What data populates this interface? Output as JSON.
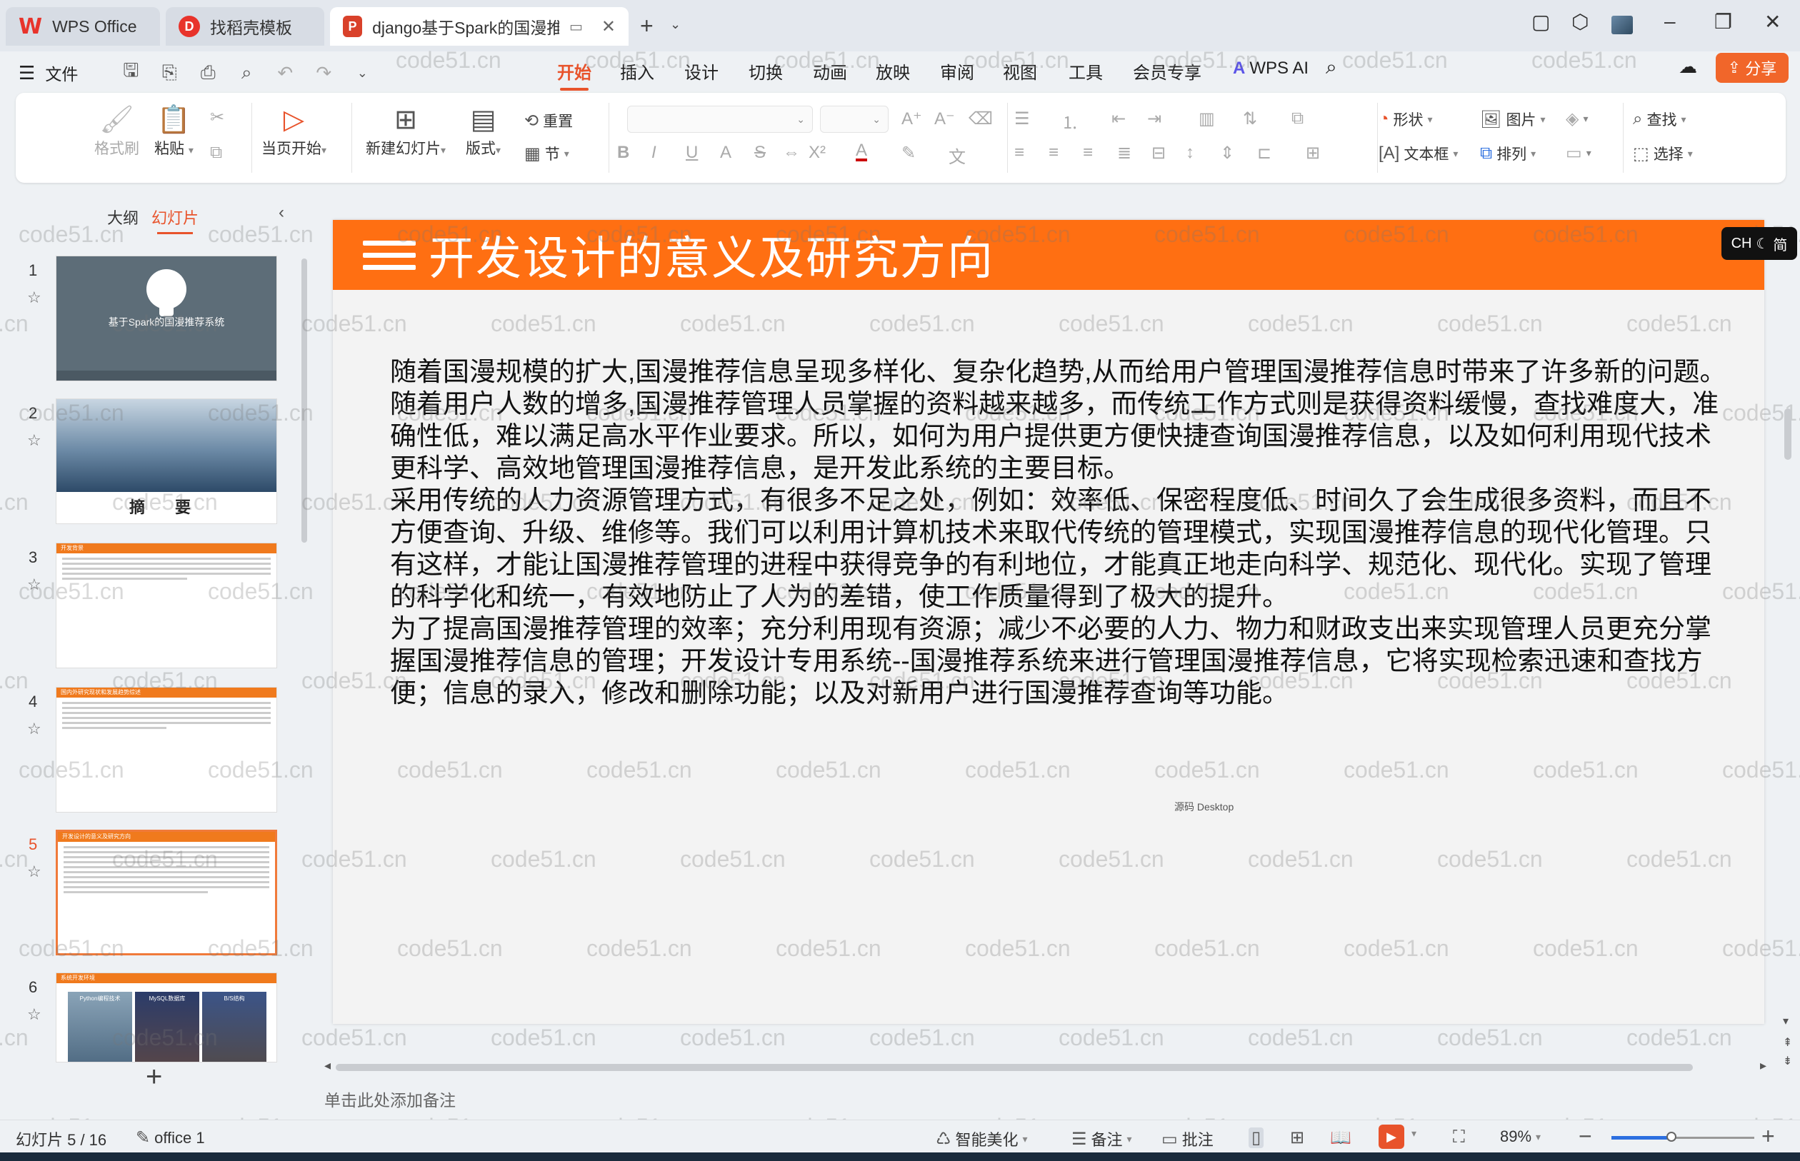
{
  "tabs": [
    {
      "label": "WPS Office",
      "icon": "wps-logo-icon"
    },
    {
      "label": "找稻壳模板",
      "icon": "docer-logo-icon"
    },
    {
      "label": "django基于Spark的国漫推荐",
      "icon": "presentation-logo-icon"
    }
  ],
  "menu": {
    "file": "文件",
    "tabs": [
      "开始",
      "插入",
      "设计",
      "切换",
      "动画",
      "放映",
      "审阅",
      "视图",
      "工具",
      "会员专享"
    ],
    "active_tab": "开始",
    "wps_ai": "WPS AI",
    "share": "分享"
  },
  "ribbon": {
    "format_painter": "格式刷",
    "paste": "粘贴",
    "play_from_current": "当页开始",
    "new_slide": "新建幻灯片",
    "layout": "版式",
    "reset": "重置",
    "section": "节",
    "shape": "形状",
    "picture": "图片",
    "textbox": "文本框",
    "arrange": "排列",
    "find": "查找",
    "select": "选择"
  },
  "panel": {
    "outline_tab": "大纲",
    "slides_tab": "幻灯片",
    "slides": [
      {
        "num": "1",
        "title": "基于Spark的国漫推荐系统"
      },
      {
        "num": "2",
        "title": "摘 要"
      },
      {
        "num": "3",
        "title": "开发背景"
      },
      {
        "num": "4",
        "title": "国内外研究现状和发展趋势综述"
      },
      {
        "num": "5",
        "title": "开发设计的意义及研究方向"
      },
      {
        "num": "6",
        "title": "系统开发环境",
        "pics": [
          "Python编程技术",
          "MySQL数据库",
          "B/S结构"
        ]
      }
    ],
    "active_slide": "5"
  },
  "slide": {
    "title": "开发设计的意义及研究方向",
    "paragraphs": [
      "随着国漫规模的扩大,国漫推荐信息呈现多样化、复杂化趋势,从而给用户管理国漫推荐信息时带来了许多新的问题。随着用户人数的增多,国漫推荐管理人员掌握的资料越来越多，而传统工作方式则是获得资料缓慢，查找难度大，准确性低，难以满足高水平作业要求。所以，如何为用户提供更方便快捷查询国漫推荐信息，以及如何利用现代技术更科学、高效地管理国漫推荐信息，是开发此系统的主要目标。",
      "采用传统的人力资源管理方式，有很多不足之处，例如：效率低、保密程度低、时间久了会生成很多资料，而且不方便查询、升级、维修等。我们可以利用计算机技术来取代传统的管理模式，实现国漫推荐信息的现代化管理。只有这样，才能让国漫推荐管理的进程中获得竞争的有利地位，才能真正地走向科学、规范化、现代化。实现了管理的科学化和统一，有效地防止了人为的差错，使工作质量得到了极大的提升。",
      "为了提高国漫推荐管理的效率；充分利用现有资源；减少不必要的人力、物力和财政支出来实现管理人员更充分掌握国漫推荐信息的管理；开发设计专用系统--国漫推荐系统来进行管理国漫推荐信息，它将实现检索迅速和查找方便；信息的录入，修改和删除功能；以及对新用户进行国漫推荐查询等功能。"
    ],
    "bubble": "源码 Desktop"
  },
  "watermark": "code51.cn",
  "ime": {
    "lang": "CH",
    "mode": "简"
  },
  "notes_placeholder": "单击此处添加备注",
  "status": {
    "slide_counter": "幻灯片 5 / 16",
    "theme": "office 1",
    "beautify": "智能美化",
    "notes": "备注",
    "comments": "批注",
    "zoom": "89%",
    "zoom_fraction": 0.42
  },
  "colors": {
    "accent": "#e8532b",
    "slide_header": "#ff6f12",
    "share_button": "#f1662a"
  }
}
